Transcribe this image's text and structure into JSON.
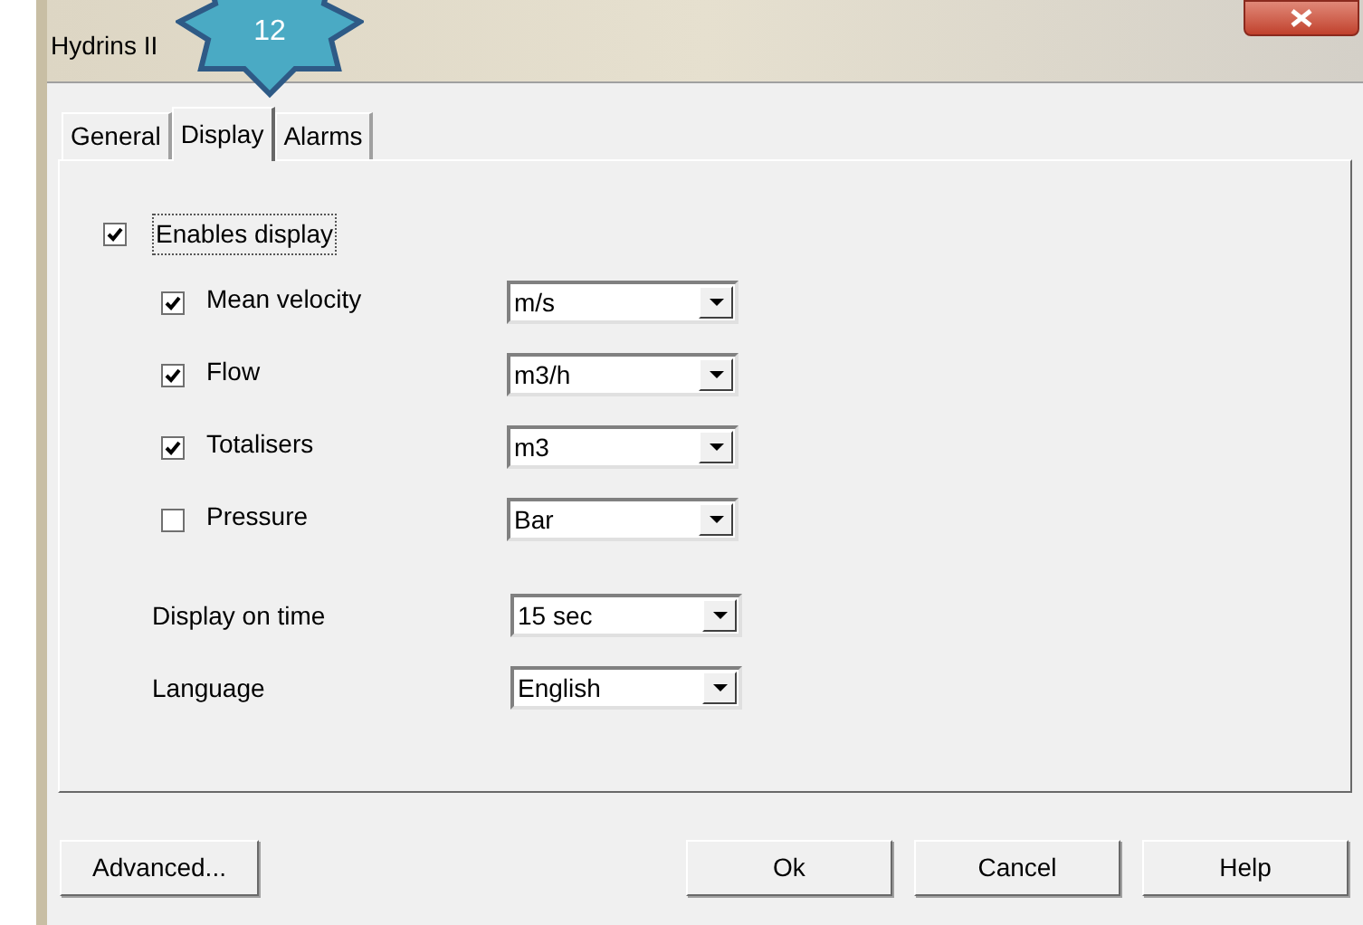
{
  "window": {
    "title": "Hydrins II"
  },
  "callout": {
    "text": "12"
  },
  "tabs": [
    {
      "label": "General",
      "selected": false
    },
    {
      "label": "Display",
      "selected": true
    },
    {
      "label": "Alarms",
      "selected": false
    }
  ],
  "enable_display": {
    "label": "Enables display",
    "checked": true
  },
  "measures": [
    {
      "label": "Mean velocity",
      "checked": true,
      "unit": "m/s"
    },
    {
      "label": "Flow",
      "checked": true,
      "unit": "m3/h"
    },
    {
      "label": "Totalisers",
      "checked": true,
      "unit": "m3"
    },
    {
      "label": "Pressure",
      "checked": false,
      "unit": "Bar"
    }
  ],
  "settings": [
    {
      "label": "Display on time",
      "value": "15 sec"
    },
    {
      "label": "Language",
      "value": "English"
    }
  ],
  "buttons": [
    {
      "label": "Advanced...",
      "kind": "left"
    },
    {
      "label": "Ok",
      "kind": "right"
    },
    {
      "label": "Cancel",
      "kind": "right"
    },
    {
      "label": "Help",
      "kind": "right"
    }
  ]
}
